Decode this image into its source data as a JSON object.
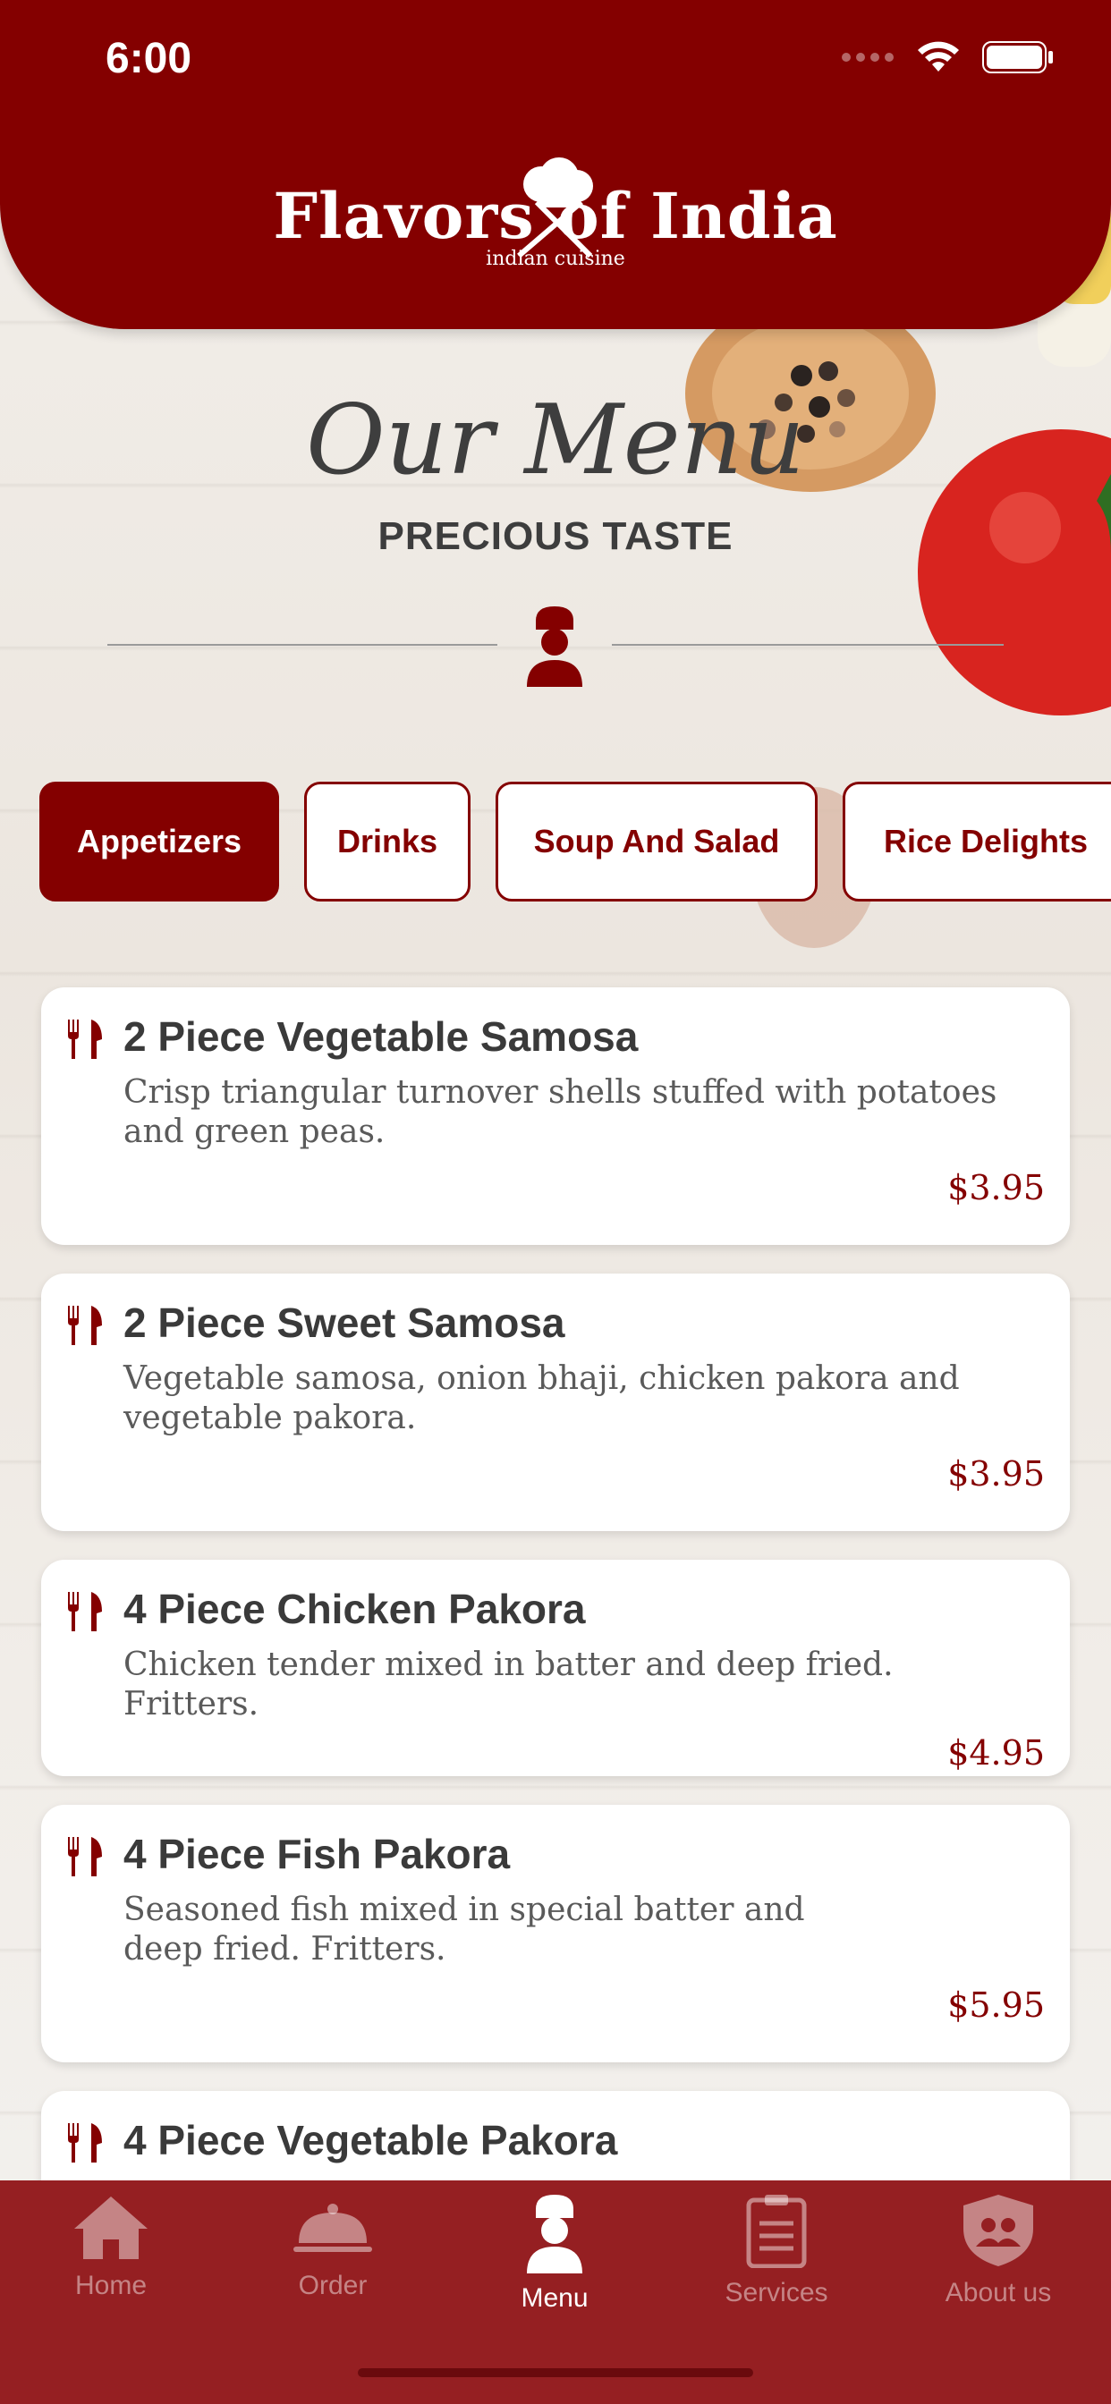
{
  "status_bar": {
    "time": "6:00"
  },
  "brand": {
    "name": "Flavors of India",
    "tagline": "indian cuisine"
  },
  "hero": {
    "title": "Our Menu",
    "subtitle": "PRECIOUS TASTE"
  },
  "categories": [
    {
      "label": "Appetizers",
      "active": true
    },
    {
      "label": "Drinks"
    },
    {
      "label": "Soup And Salad"
    },
    {
      "label": "Rice Delights"
    }
  ],
  "items": [
    {
      "name": "2 Piece Vegetable Samosa",
      "description": "Crisp triangular turnover shells stuffed with potatoes and green peas.",
      "price": "$3.95"
    },
    {
      "name": "2 Piece Sweet Samosa",
      "description": "Vegetable samosa, onion bhaji, chicken pakora and vegetable pakora.",
      "price": "$3.95"
    },
    {
      "name": "4 Piece Chicken Pakora",
      "description": "Chicken tender mixed in batter and deep fried. Fritters.",
      "price": "$4.95"
    },
    {
      "name": "4 Piece Fish Pakora",
      "description": "Seasoned fish mixed in special batter and deep fried. Fritters.",
      "price": "$5.95"
    },
    {
      "name": "4 Piece Vegetable Pakora"
    }
  ],
  "nav": [
    {
      "label": "Home",
      "icon": "home-icon"
    },
    {
      "label": "Order",
      "icon": "cloche-icon"
    },
    {
      "label": "Menu",
      "icon": "chef-icon",
      "active": true
    },
    {
      "label": "Services",
      "icon": "clipboard-icon"
    },
    {
      "label": "About us",
      "icon": "shield-people-icon"
    }
  ],
  "colors": {
    "primary": "#840000",
    "nav_bg": "#951f22"
  }
}
